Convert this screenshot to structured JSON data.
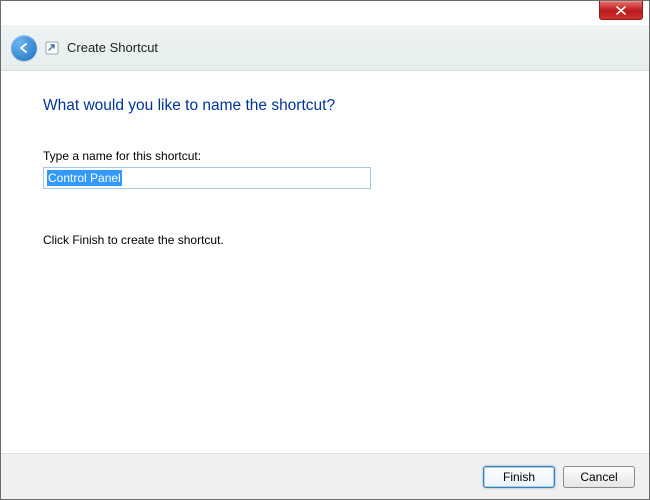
{
  "window": {
    "close_icon": "close"
  },
  "header": {
    "title": "Create Shortcut",
    "back_icon": "back-arrow",
    "mini_icon": "shortcut"
  },
  "content": {
    "heading": "What would you like to name the shortcut?",
    "field_label": "Type a name for this shortcut:",
    "shortcut_name": "Control Panel",
    "hint": "Click Finish to create the shortcut."
  },
  "footer": {
    "finish_label": "Finish",
    "cancel_label": "Cancel"
  }
}
